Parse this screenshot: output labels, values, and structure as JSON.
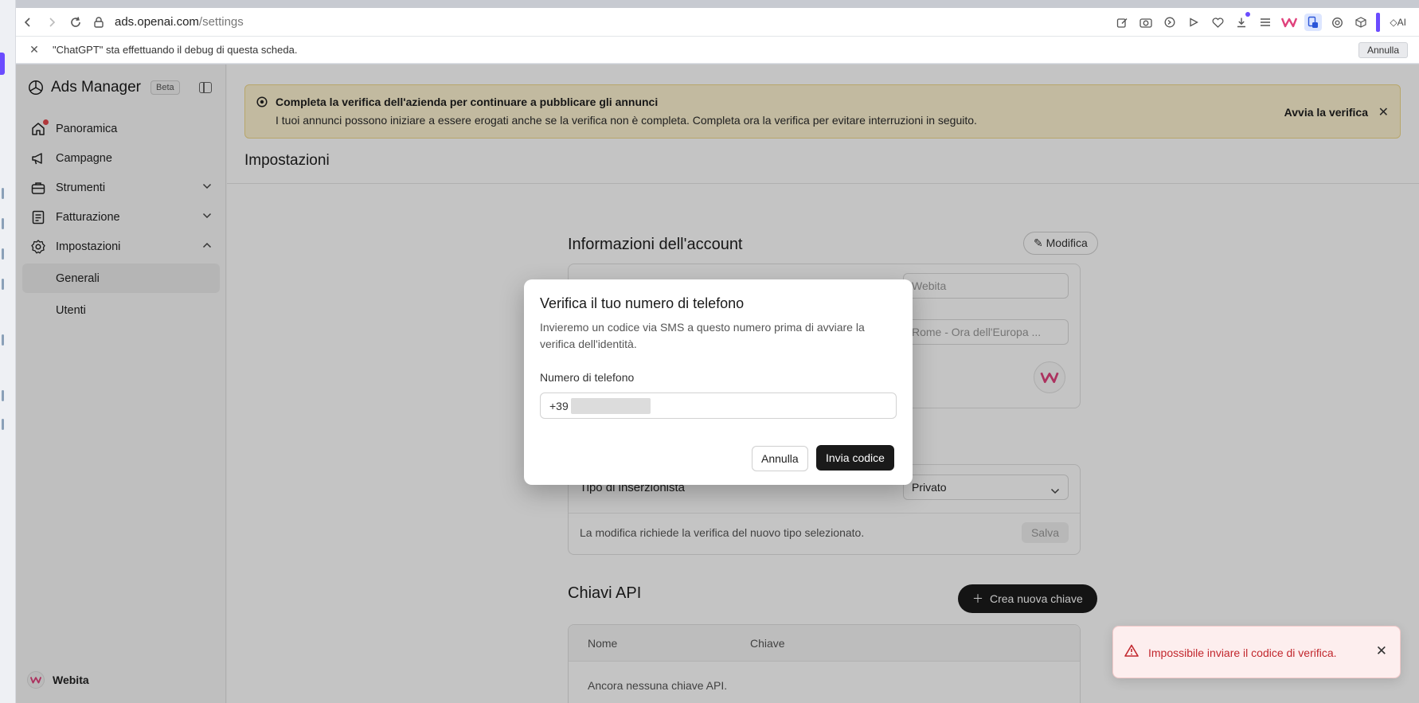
{
  "browser": {
    "url_host": "ads.openai.com",
    "url_path": "/settings",
    "debug_message": "\"ChatGPT\" sta effettuando il debug di questa scheda.",
    "debug_cancel_label": "Annulla",
    "ai_label": "AI"
  },
  "sidebar": {
    "brand_title": "Ads Manager",
    "beta_label": "Beta",
    "items": [
      {
        "label": "Panoramica",
        "icon": "home-icon"
      },
      {
        "label": "Campagne",
        "icon": "megaphone-icon"
      },
      {
        "label": "Strumenti",
        "icon": "briefcase-icon"
      },
      {
        "label": "Fatturazione",
        "icon": "receipt-icon"
      },
      {
        "label": "Impostazioni",
        "icon": "gear-icon"
      }
    ],
    "sub_items": [
      {
        "label": "Generali",
        "active": true
      },
      {
        "label": "Utenti",
        "active": false
      }
    ],
    "workspace_name": "Webita"
  },
  "banner": {
    "title": "Completa la verifica dell'azienda per continuare a pubblicare gli annunci",
    "text": "I tuoi annunci possono iniziare a essere erogati anche se la verifica non è completa. Completa ora la verifica per evitare interruzioni in seguito.",
    "action_label": "Avvia la verifica",
    "color": "#fdf3d1"
  },
  "main": {
    "page_title": "Impostazioni",
    "account_section_title": "Informazioni dell'account",
    "edit_label": "Modifica",
    "account_name_value": "Webita",
    "timezone_value": "Rome - Ora dell'Europa ...",
    "advertiser_type_label": "Tipo di inserzionista",
    "advertiser_type_value": "Privato",
    "advertiser_type_note": "La modifica richiede la verifica del nuovo tipo selezionato.",
    "save_label": "Salva",
    "api_section_title": "Chiavi API",
    "create_key_label": "Crea nuova chiave",
    "api_columns": [
      "Nome",
      "Chiave"
    ],
    "api_empty": "Ancora nessuna chiave API."
  },
  "modal": {
    "title": "Verifica il tuo numero di telefono",
    "description": "Invieremo un codice via SMS a questo numero prima di avviare la verifica dell'identità.",
    "field_label": "Numero di telefono",
    "phone_prefix": "+39",
    "cancel_label": "Annulla",
    "submit_label": "Invia codice"
  },
  "toast": {
    "message": "Impossibile inviare il codice di verifica.",
    "color": "#c2272d"
  }
}
